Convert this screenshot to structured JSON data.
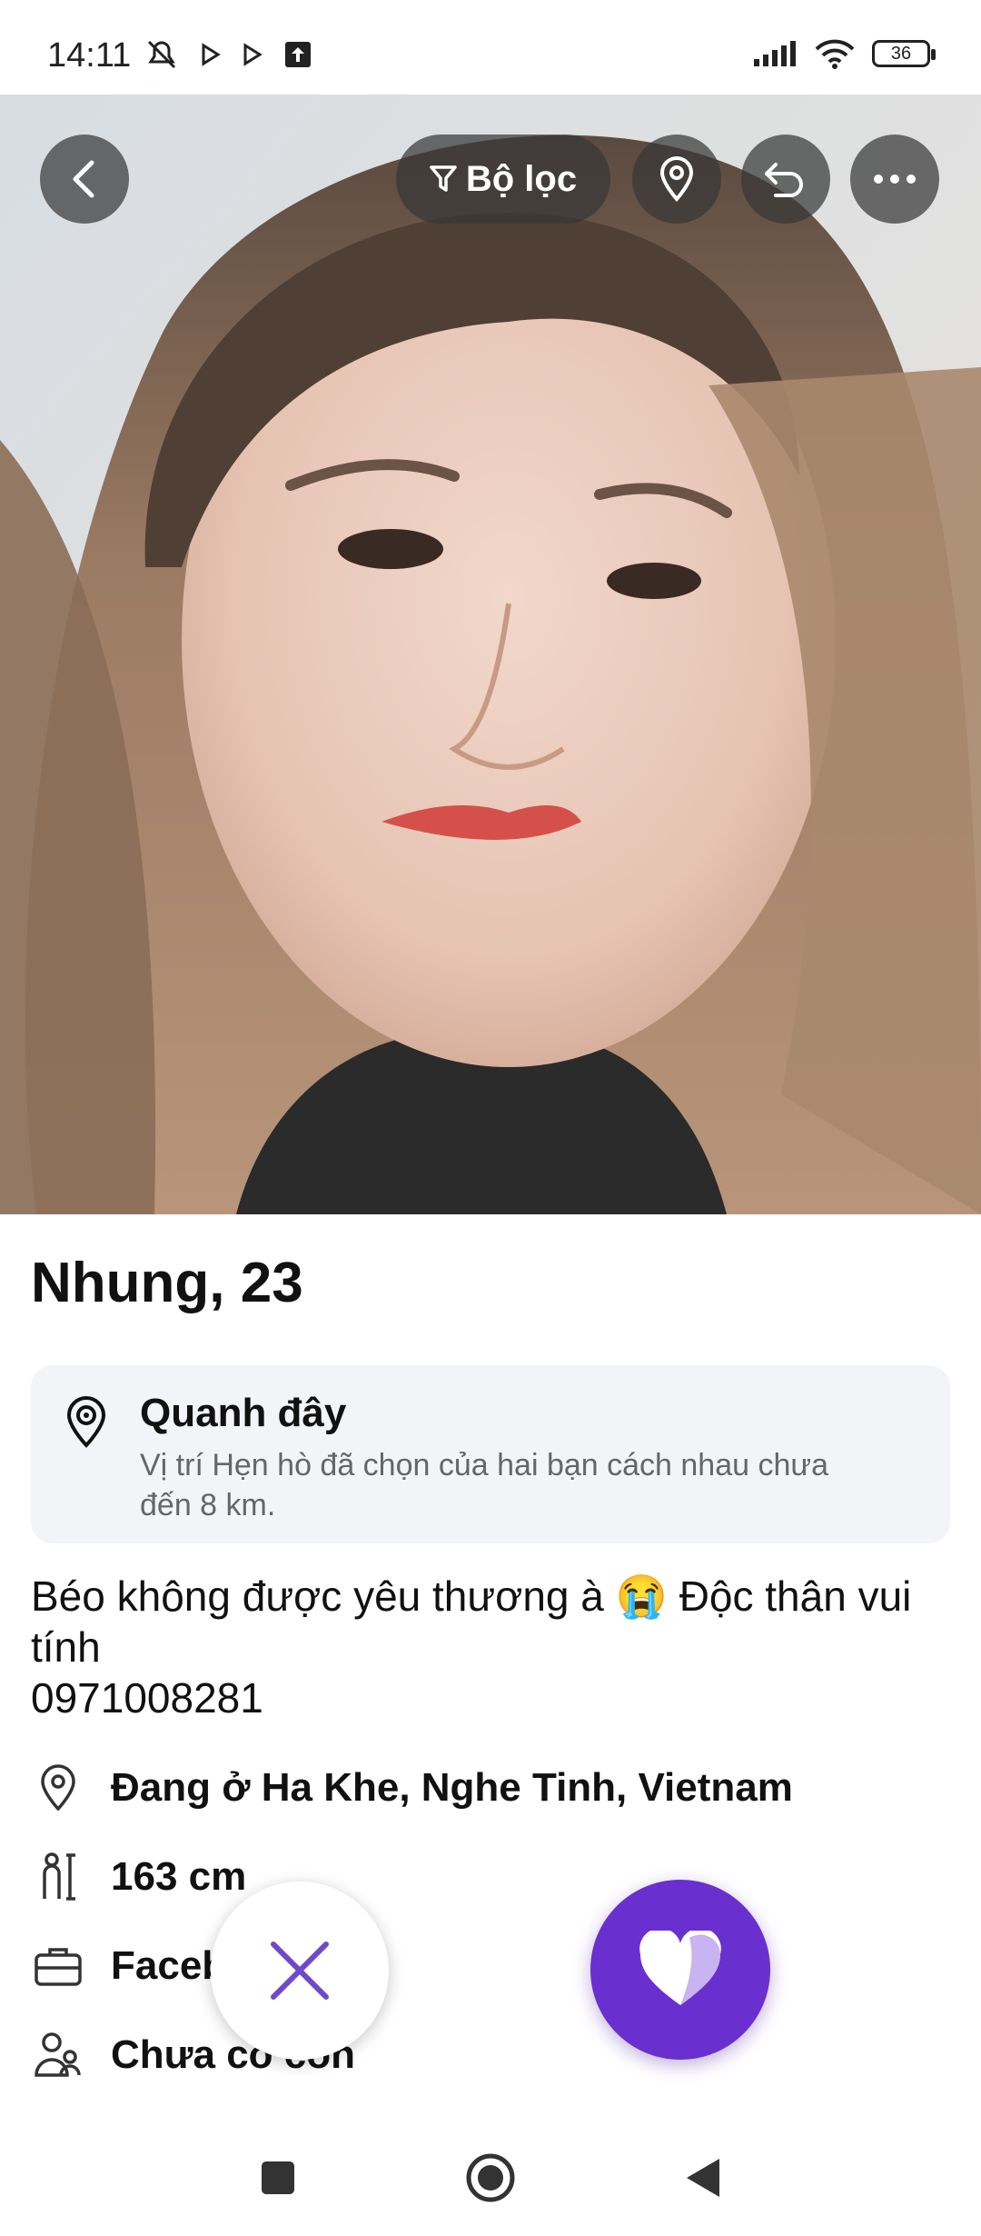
{
  "status_bar": {
    "time": "14:11",
    "battery": "36",
    "icons": [
      "mute-icon",
      "play-icon",
      "play-icon",
      "upload-icon",
      "signal-icon",
      "wifi-icon",
      "battery-icon"
    ]
  },
  "top_bar": {
    "filter_label": "Bộ lọc"
  },
  "profile": {
    "name_age": "Nhung, 23",
    "nearby": {
      "title": "Quanh đây",
      "description": "Vị trí Hẹn hò đã chọn của hai bạn cách nhau chưa đến 8 km."
    },
    "bio": {
      "line1": "Béo không được yêu thương  à 😭 Độc thân vui tính",
      "line2": "0971008281"
    },
    "info": {
      "location": "Đang ở Ha Khe, Nghe Tinh, Vietnam",
      "height": "163 cm",
      "work": "Facebook",
      "children": "Chưa có con"
    }
  },
  "colors": {
    "accent": "#6a2fcf",
    "card_bg": "#f3f4f7",
    "overlay_button": "#373737"
  }
}
